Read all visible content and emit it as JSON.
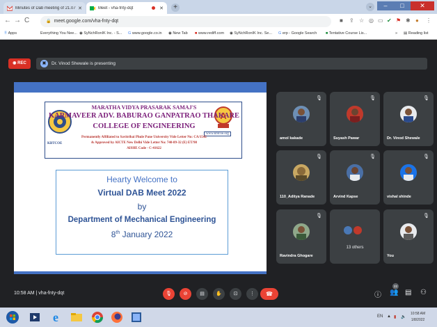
{
  "browser": {
    "tabs": [
      {
        "title": "Minutes of Dab meeting of 21.07"
      },
      {
        "title": "Meet - vha-fnty-dqt"
      }
    ],
    "new_tab": "+",
    "url": "meet.google.com/vha-fnty-dqt",
    "bookmarks": [
      "Apps",
      "Everything You Nee...",
      "SyNchRonIK Inc. - S...",
      "www.google.co.in",
      "New Tab",
      "www.rediff.com",
      "SyNchRonIK Inc. Se...",
      "erp - Google Search",
      "Tentative Course Lis..."
    ],
    "reading_list": "Reading list",
    "overflow": "»"
  },
  "meet": {
    "rec_label": "REC",
    "presenting_text": "Dr. Vinod Shewale is presenting",
    "slide": {
      "header_line1": "MARATHA VIDYA PRASARAK SAMAJ'S",
      "header_line2": "KARMAVEER ADV. BABURAO GANPATRAO THAKARE",
      "header_line3": "COLLEGE OF ENGINEERING",
      "header_line4": "Permanently Affiliated to Savitribai Phule Pune University Vide Letter No: CA/1542",
      "header_line5": "& Approved by AICTE New Delhi Vide Letter No: 740-89-32 (E) ET/98",
      "header_line6": "AISHE Code - C-41622",
      "logo_left_text": "KBTCOE",
      "website": "www.kbtcoe.org",
      "badge_letter": "A",
      "welcome1": "Hearty Welcome to",
      "welcome2": "Virtual DAB Meet 2022",
      "welcome3": "by",
      "welcome4": "Department of Mechanical Engineering",
      "welcome5_day": "8",
      "welcome5_sup": "th",
      "welcome5_rest": " January 2022"
    },
    "participants": [
      {
        "name": "amol kakade"
      },
      {
        "name": "Suyash Pawar"
      },
      {
        "name": "Dr. Vinod Shewale"
      },
      {
        "name": "110_Aditya Ranade"
      },
      {
        "name": "Arvind Kapse"
      },
      {
        "name": "vishal shinde"
      },
      {
        "name": "Ravindra Ghogare"
      },
      {
        "name": "13 others"
      },
      {
        "name": "You"
      }
    ],
    "meeting_time": "10:58 AM",
    "meeting_code": "vha-fnty-dqt",
    "people_count": "22"
  },
  "taskbar": {
    "lang": "EN",
    "time": "10:58 AM",
    "date": "1/8/2022"
  },
  "colors": {
    "meet_bg": "#202124",
    "tile_bg": "#3c4043",
    "red": "#ea4335",
    "slide_blue": "#4472c4",
    "college_purple": "#7b1f7a"
  }
}
